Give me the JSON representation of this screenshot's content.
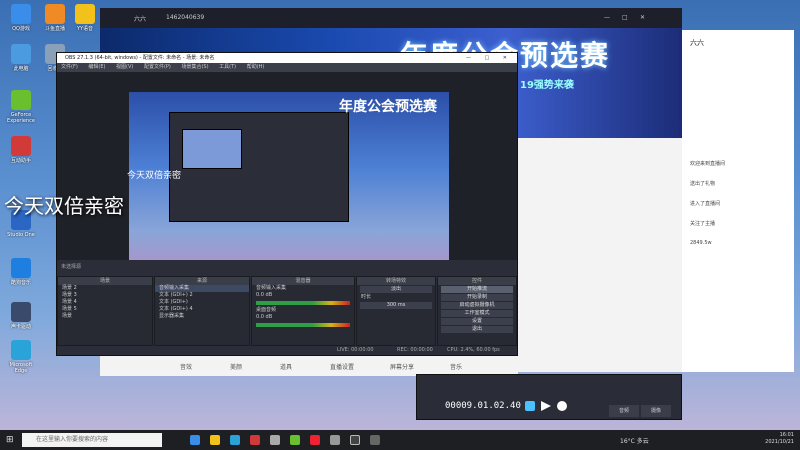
{
  "desktop_icons": [
    {
      "label": "QQ游戏",
      "color": "#3a8de8"
    },
    {
      "label": "斗鱼直播",
      "color": "#f08a24"
    },
    {
      "label": "YY语音",
      "color": "#f2c21a"
    },
    {
      "label": "此电脑",
      "color": "#4a9be0"
    },
    {
      "label": "回收站",
      "color": "#8aa0b8"
    },
    {
      "label": "GeForce Experience",
      "color": "#6abf2e"
    },
    {
      "label": "互动助手",
      "color": "#d23a3a"
    },
    {
      "label": "Studio One",
      "color": "#2a66c4"
    },
    {
      "label": "酷狗音乐",
      "color": "#1f7fe0"
    },
    {
      "label": "声卡驱动",
      "color": "#3a4a6a"
    },
    {
      "label": "Microsoft Edge",
      "color": "#2aa3d8"
    }
  ],
  "background_app": {
    "user_name": "六六",
    "user_id": "1462040639",
    "banner_title": "年度公会预选赛",
    "banner_sub": "19强势来袭",
    "toolbar": [
      "音效",
      "美颜",
      "道具",
      "直播设置",
      "屏幕分享",
      "音乐"
    ],
    "right_panel_title": "六六",
    "chat_lines": [
      "欢迎来到直播间",
      "送出了礼物",
      "进入了直播间",
      "关注了主播",
      "2849.5w"
    ]
  },
  "obs": {
    "title": "OBS 27.1.3 (64-bit, windows) - 配置文件: 未命名 - 场景: 未命名",
    "menu": [
      "文件(F)",
      "编辑(E)",
      "视图(V)",
      "配置文件(P)",
      "场景集合(S)",
      "工具(T)",
      "帮助(H)"
    ],
    "preview_overlay_text": "今天双倍亲密",
    "no_source": "未选择源",
    "dock_titles": {
      "scenes": "场景",
      "sources": "来源",
      "mixer": "混音器",
      "transitions": "转场特效",
      "controls": "控件"
    },
    "scenes": [
      "场景 2",
      "场景 3",
      "场景 4",
      "场景 5",
      "场景"
    ],
    "sources": [
      "音频输入采集",
      "文本 (GDI+) 2",
      "文本 (GDI+)",
      "文本 (GDI+) 4",
      "显示器采集"
    ],
    "mixer_channels": [
      {
        "name": "音频输入采集",
        "db": "0.0 dB"
      },
      {
        "name": "桌面音频",
        "db": "0.0 dB"
      }
    ],
    "transition": {
      "type": "淡出",
      "duration_label": "时长",
      "duration": "300 ms"
    },
    "controls": [
      "开始推流",
      "开始录制",
      "启动虚拟摄像机",
      "工作室模式",
      "设置",
      "退出"
    ],
    "status": {
      "live": "LIVE: 00:00:00",
      "rec": "REC: 00:00:00",
      "cpu": "CPU: 2.4%, 60.00 fps"
    }
  },
  "big_overlay": "今天双倍亲密",
  "mixer_panel": {
    "timer": "00009.01.02.40",
    "labels": [
      "音频",
      "摄像",
      "混音"
    ]
  },
  "taskbar": {
    "search_placeholder": "在这里输入你要搜索的内容",
    "weather": "16°C 多云",
    "time": "16:01",
    "date": "2021/10/21"
  }
}
